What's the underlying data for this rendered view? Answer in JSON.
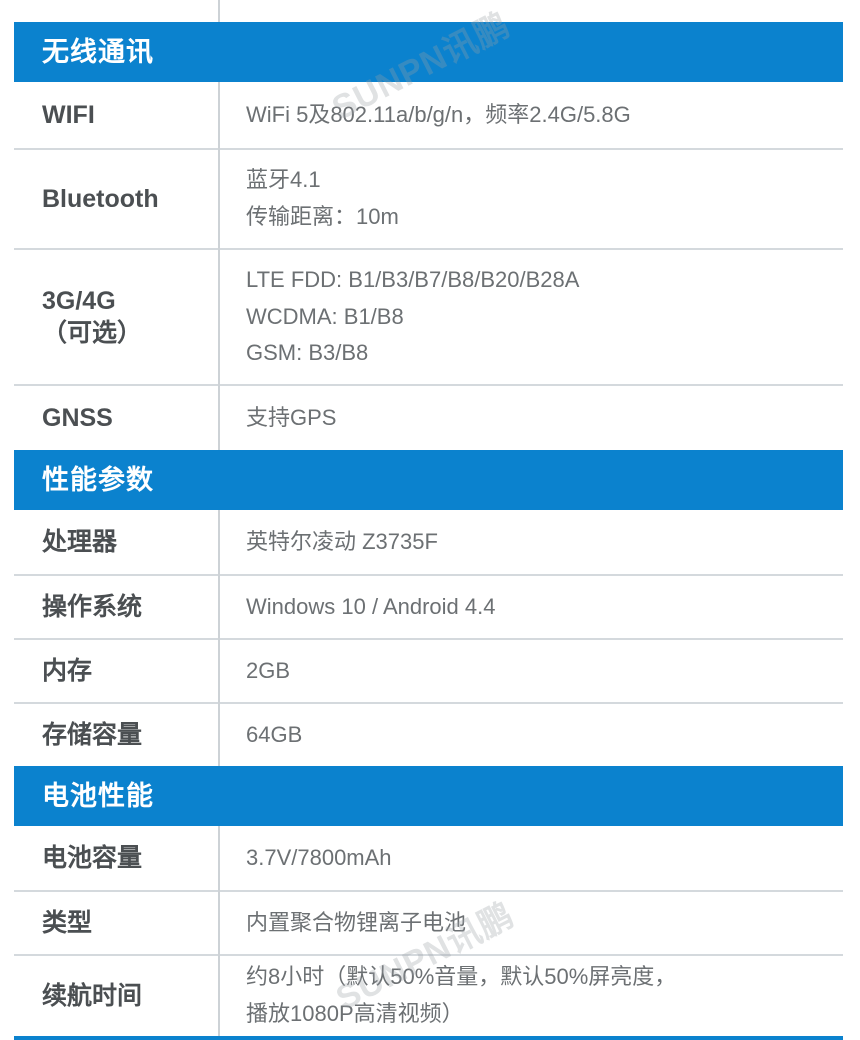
{
  "page": {
    "accent_color": "#0b82ce",
    "label_color": "#4b4f52",
    "value_color": "#6c7073",
    "divider_color": "#d4d9dd",
    "watermark_text": "SUNPN讯鹏"
  },
  "sections": [
    {
      "id": "wireless",
      "title": "无线通讯",
      "rows": [
        {
          "label": [
            "WIFI"
          ],
          "value": [
            "WiFi 5及802.11a/b/g/n，频率2.4G/5.8G"
          ]
        },
        {
          "label": [
            "Bluetooth"
          ],
          "value": [
            "蓝牙4.1",
            "传输距离：10m"
          ]
        },
        {
          "label": [
            "3G/4G",
            "（可选）"
          ],
          "value": [
            "LTE FDD: B1/B3/B7/B8/B20/B28A",
            "WCDMA: B1/B8",
            "GSM: B3/B8"
          ]
        },
        {
          "label": [
            "GNSS"
          ],
          "value": [
            "支持GPS"
          ]
        }
      ]
    },
    {
      "id": "performance",
      "title": "性能参数",
      "rows": [
        {
          "label": [
            "处理器"
          ],
          "value": [
            "英特尔凌动 Z3735F"
          ]
        },
        {
          "label": [
            "操作系统"
          ],
          "value": [
            "Windows 10 / Android 4.4"
          ]
        },
        {
          "label": [
            "内存"
          ],
          "value": [
            "2GB"
          ]
        },
        {
          "label": [
            "存储容量"
          ],
          "value": [
            "64GB"
          ]
        }
      ]
    },
    {
      "id": "battery",
      "title": "电池性能",
      "rows": [
        {
          "label": [
            "电池容量"
          ],
          "value": [
            "3.7V/7800mAh"
          ]
        },
        {
          "label": [
            "类型"
          ],
          "value": [
            "内置聚合物锂离子电池"
          ]
        },
        {
          "label": [
            "续航时间"
          ],
          "value": [
            "约8小时（默认50%音量，默认50%屏亮度，",
            "播放1080P高清视频）"
          ]
        }
      ]
    }
  ]
}
